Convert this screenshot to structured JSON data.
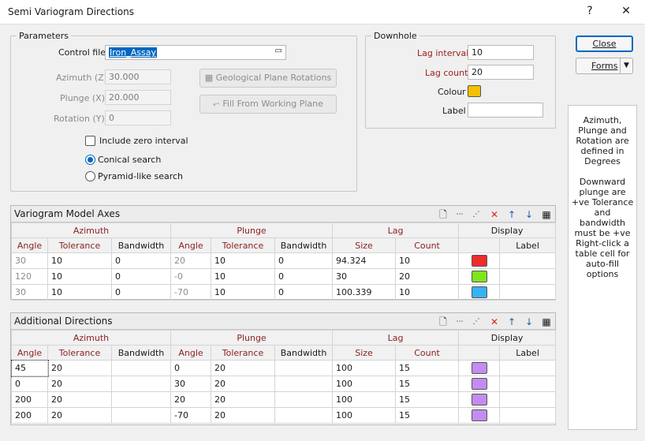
{
  "window": {
    "title": "Semi Variogram Directions",
    "help": "?",
    "close": "✕"
  },
  "parameters": {
    "legend": "Parameters",
    "control_file_label": "Control file",
    "control_file_value": "Iron_Assay",
    "azimuth_label": "Azimuth (Z)",
    "azimuth_value": "30.000",
    "plunge_label": "Plunge (X)",
    "plunge_value": "20.000",
    "rotation_label": "Rotation (Y)",
    "rotation_value": "0",
    "geo_plane_button": "Geological Plane Rotations",
    "fill_button": "Fill From Working Plane",
    "include_zero": "Include zero interval",
    "conical": "Conical search",
    "pyramid": "Pyramid-like search"
  },
  "downhole": {
    "legend": "Downhole",
    "lag_interval_label": "Lag interval",
    "lag_interval_value": "10",
    "lag_count_label": "Lag count",
    "lag_count_value": "20",
    "colour_label": "Colour",
    "colour_value": "#f5c000",
    "label_label": "Label",
    "label_value": ""
  },
  "buttons": {
    "close": "Close",
    "forms": "Forms"
  },
  "info": {
    "p1": "Azimuth, Plunge and Rotation are defined in Degrees",
    "p2": "Downward plunge are +ve Tolerance and bandwidth must be +ve",
    "p3": "Right-click a table cell for auto-fill options"
  },
  "groups": {
    "azimuth": "Azimuth",
    "plunge": "Plunge",
    "lag": "Lag",
    "display": "Display"
  },
  "columns": [
    "Angle",
    "Tolerance",
    "Bandwidth",
    "Angle",
    "Tolerance",
    "Bandwidth",
    "Size",
    "Count",
    "",
    "Label"
  ],
  "model_axes": {
    "title": "Variogram Model Axes",
    "rows": [
      {
        "az": "30",
        "az_tol": "10",
        "az_bw": "0",
        "pl": "20",
        "pl_tol": "10",
        "pl_bw": "0",
        "size": "94.324",
        "count": "10",
        "color": "#f02b2b",
        "label": ""
      },
      {
        "az": "120",
        "az_tol": "10",
        "az_bw": "0",
        "pl": "-0",
        "pl_tol": "10",
        "pl_bw": "0",
        "size": "30",
        "count": "20",
        "color": "#7ee61a",
        "label": ""
      },
      {
        "az": "30",
        "az_tol": "10",
        "az_bw": "0",
        "pl": "-70",
        "pl_tol": "10",
        "pl_bw": "0",
        "size": "100.339",
        "count": "10",
        "color": "#38b2f2",
        "label": ""
      }
    ]
  },
  "additional": {
    "title": "Additional Directions",
    "rows": [
      {
        "az": "45",
        "az_tol": "20",
        "az_bw": "",
        "pl": "0",
        "pl_tol": "20",
        "pl_bw": "",
        "size": "100",
        "count": "15",
        "color": "#c48cf0",
        "label": ""
      },
      {
        "az": "0",
        "az_tol": "20",
        "az_bw": "",
        "pl": "30",
        "pl_tol": "20",
        "pl_bw": "",
        "size": "100",
        "count": "15",
        "color": "#c48cf0",
        "label": ""
      },
      {
        "az": "200",
        "az_tol": "20",
        "az_bw": "",
        "pl": "20",
        "pl_tol": "20",
        "pl_bw": "",
        "size": "100",
        "count": "15",
        "color": "#c48cf0",
        "label": ""
      },
      {
        "az": "200",
        "az_tol": "20",
        "az_bw": "",
        "pl": "-70",
        "pl_tol": "20",
        "pl_bw": "",
        "size": "100",
        "count": "15",
        "color": "#c48cf0",
        "label": ""
      }
    ]
  }
}
